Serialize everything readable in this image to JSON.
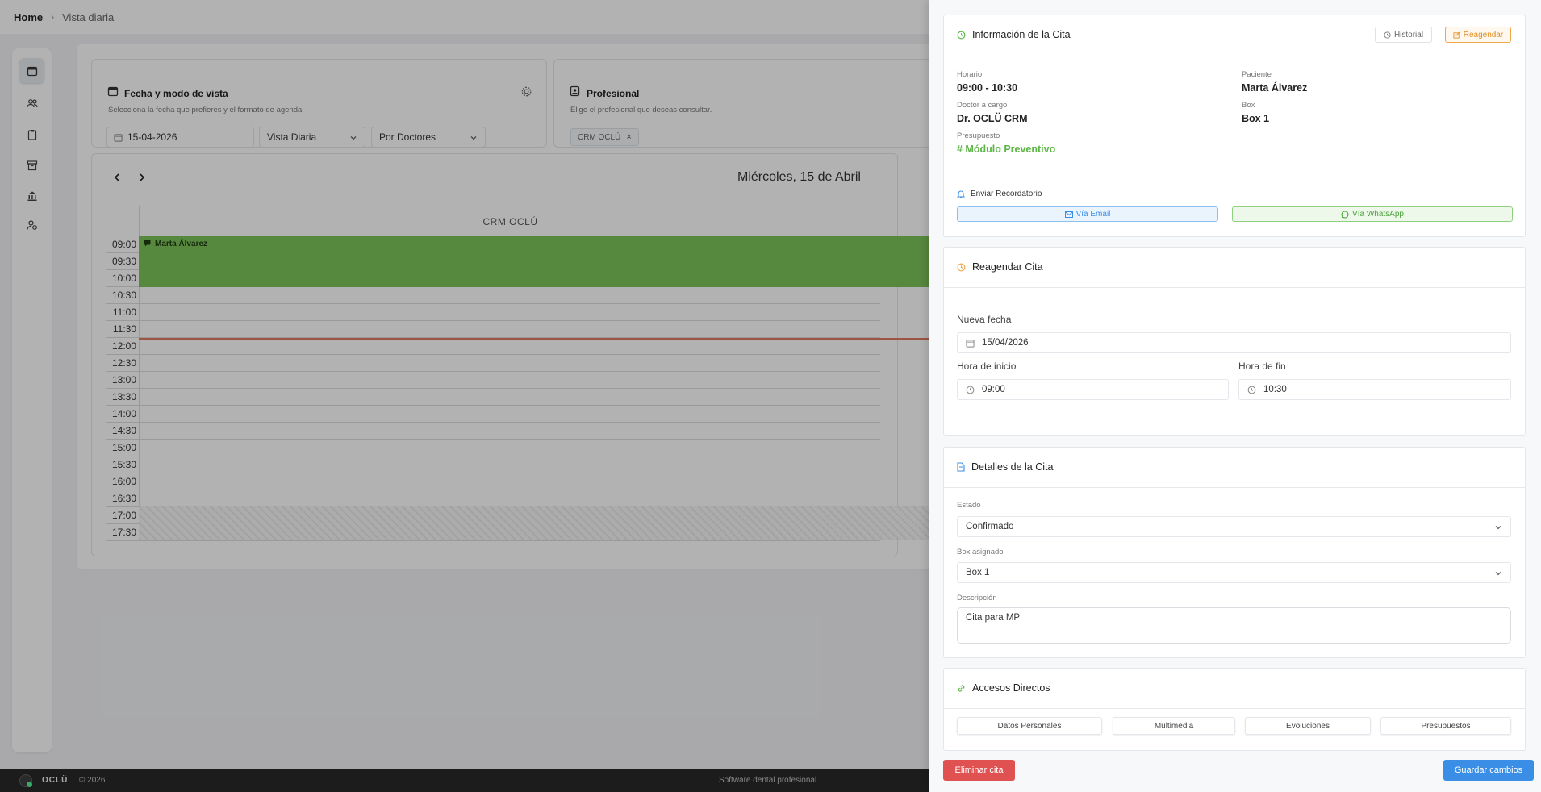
{
  "breadcrumb": {
    "home": "Home",
    "current": "Vista diaria"
  },
  "rail_icons": [
    "calendar-icon",
    "users-icon",
    "clipboard-icon",
    "archive-icon",
    "bank-icon",
    "user-settings-icon"
  ],
  "date_card": {
    "title": "Fecha y modo de vista",
    "subtitle": "Selecciona la fecha que prefieres y el formato de agenda.",
    "date_value": "15-04-2026",
    "view_mode": "Vista Diaria",
    "group_by": "Por Doctores"
  },
  "professional_card": {
    "title": "Profesional",
    "subtitle": "Elige el profesional que deseas consultar.",
    "tag": "CRM OCLÚ"
  },
  "calendar": {
    "day_title": "Miércoles, 15 de Abril",
    "column_header": "CRM OCLÚ",
    "times": [
      "09:00",
      "09:30",
      "10:00",
      "10:30",
      "11:00",
      "11:30",
      "12:00",
      "12:30",
      "13:00",
      "13:30",
      "14:00",
      "14:30",
      "15:00",
      "15:30",
      "16:00",
      "16:30",
      "17:00",
      "17:30"
    ],
    "appointment_patient": "Marta Álvarez",
    "appointment_color": "#7cc35a"
  },
  "footer": {
    "brand": "OCLÜ",
    "copyright": "© 2026",
    "tagline": "Software dental profesional"
  },
  "info": {
    "title": "Información de la Cita",
    "historial_btn": "Historial",
    "reagendar_btn": "Reagendar",
    "horario_label": "Horario",
    "horario_value": "09:00 - 10:30",
    "paciente_label": "Paciente",
    "paciente_value": "Marta Álvarez",
    "doctor_label": "Doctor a cargo",
    "doctor_value": "Dr. OCLÜ CRM",
    "box_label": "Box",
    "box_value": "Box 1",
    "presupuesto_label": "Presupuesto",
    "presupuesto_value": "# Módulo Preventivo",
    "reminder_title": "Enviar Recordatorio",
    "email_btn": "Vía Email",
    "whatsapp_btn": "Vía WhatsApp"
  },
  "reschedule": {
    "title": "Reagendar Cita",
    "new_date_label": "Nueva fecha",
    "new_date_value": "15/04/2026",
    "start_label": "Hora de inicio",
    "start_value": "09:00",
    "end_label": "Hora de fin",
    "end_value": "10:30"
  },
  "details": {
    "title": "Detalles de la Cita",
    "estado_label": "Estado",
    "estado_value": "Confirmado",
    "box_label": "Box asignado",
    "box_value": "Box 1",
    "desc_label": "Descripción",
    "desc_value": "Cita para MP"
  },
  "shortcuts": {
    "title": "Accesos Directos",
    "items": [
      "Datos Personales",
      "Multimedia",
      "Evoluciones",
      "Presupuestos"
    ]
  },
  "actions": {
    "delete": "Eliminar cita",
    "save": "Guardar cambios"
  },
  "colors": {
    "accent_orange": "#f0a64a",
    "accent_green": "#5cb545",
    "primary_blue": "#3a8ee6",
    "danger_red": "#e05252"
  }
}
